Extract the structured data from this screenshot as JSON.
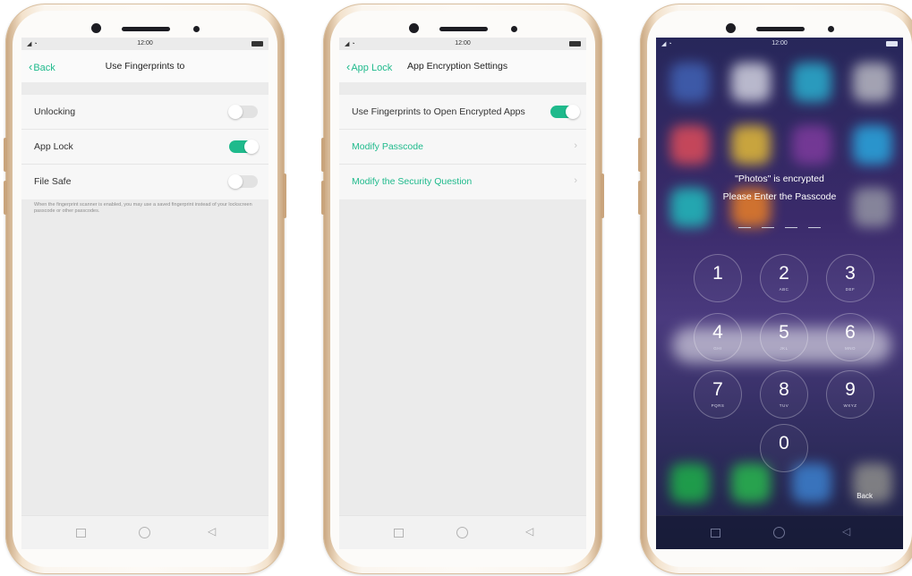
{
  "status": {
    "time": "12:00",
    "signal": "◢ ◔"
  },
  "screens": [
    {
      "back_label": "Back",
      "title": "Use Fingerprints to",
      "rows": [
        {
          "label": "Unlocking",
          "toggle": "off"
        },
        {
          "label": "App Lock",
          "toggle": "on"
        },
        {
          "label": "File Safe",
          "toggle": "off"
        }
      ],
      "note": "When the fingerprint scanner is enabled, you may use a saved fingerprint instead of your lockscreen passcode or other passcodes."
    },
    {
      "back_label": "App Lock",
      "title": "App Encryption Settings",
      "rows": [
        {
          "label": "Use Fingerprints to Open Encrypted Apps",
          "toggle": "on"
        },
        {
          "label": "Modify Passcode",
          "type": "link"
        },
        {
          "label": "Modify the Security Question",
          "type": "link"
        }
      ]
    },
    {
      "message_line1": "\"Photos\" is encrypted",
      "message_line2": "Please Enter the Passcode",
      "keypad": [
        {
          "num": "1",
          "sub": ""
        },
        {
          "num": "2",
          "sub": "ABC"
        },
        {
          "num": "3",
          "sub": "DEF"
        },
        {
          "num": "4",
          "sub": "GHI"
        },
        {
          "num": "5",
          "sub": "JKL"
        },
        {
          "num": "6",
          "sub": "MNO"
        },
        {
          "num": "7",
          "sub": "PQRS"
        },
        {
          "num": "8",
          "sub": "TUV"
        },
        {
          "num": "9",
          "sub": "WXYZ"
        },
        {
          "num": "0",
          "sub": ""
        }
      ],
      "back_label": "Back"
    }
  ],
  "nav_keys": {
    "recent": "",
    "home": "",
    "back": "◁"
  },
  "colors": {
    "accent": "#1fba8c",
    "lock_bg": "#3a2a6a",
    "phone_gold": "#c8a57e"
  }
}
